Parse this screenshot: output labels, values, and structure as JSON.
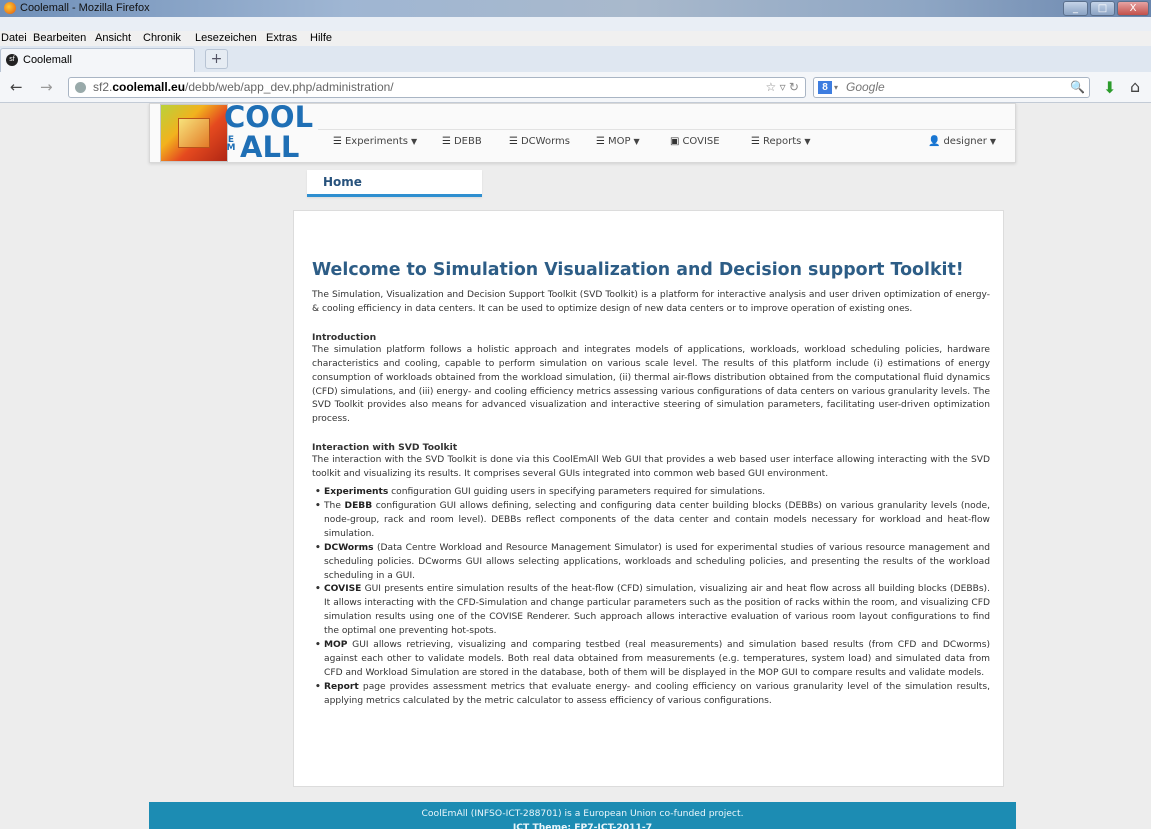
{
  "window": {
    "title": "Coolemall - Mozilla Firefox",
    "minimize_glyph": "_",
    "maximize_glyph": "□",
    "close_glyph": "X"
  },
  "menubar": [
    "Datei",
    "Bearbeiten",
    "Ansicht",
    "Chronik",
    "Lesezeichen",
    "Extras",
    "Hilfe"
  ],
  "tab": {
    "title": "Coolemall",
    "new_tab_glyph": "+"
  },
  "toolbar": {
    "url_prefix": "sf2.",
    "url_domain": "coolemall.eu",
    "url_path": "/debb/web/app_dev.php/administration/",
    "search_placeholder": "Google"
  },
  "site": {
    "logo_top": "COOL",
    "logo_bottom": "ALL",
    "logo_em": "E M",
    "nav": [
      {
        "label": "Experiments",
        "dropdown": true,
        "icon": "list-icon"
      },
      {
        "label": "DEBB",
        "dropdown": false,
        "icon": "list-icon"
      },
      {
        "label": "DCWorms",
        "dropdown": false,
        "icon": "list-icon"
      },
      {
        "label": "MOP",
        "dropdown": true,
        "icon": "list-icon"
      },
      {
        "label": "COVISE",
        "dropdown": false,
        "icon": "film-icon"
      },
      {
        "label": "Reports",
        "dropdown": true,
        "icon": "list-icon"
      }
    ],
    "user_label": "designer",
    "breadcrumb_home": "Home"
  },
  "content": {
    "heading": "Welcome to Simulation Visualization and Decision support Toolkit!",
    "intro": "The Simulation, Visualization and Decision Support Toolkit (SVD Toolkit) is a platform for interactive analysis and user driven optimization of energy- & cooling efficiency in data centers. It can be used to optimize design of new data centers or to improve operation of existing ones.",
    "introduction_heading": "Introduction",
    "introduction_text": "The simulation platform follows a holistic approach and integrates models of applications, workloads, workload scheduling policies, hardware characteristics and cooling, capable to perform simulation on various scale level. The results of this platform include (i) estimations of energy consumption of workloads obtained from the workload simulation, (ii) thermal air-flows distribution obtained from the computational fluid dynamics (CFD) simulations, and (iii) energy- and cooling efficiency metrics assessing various configurations of data centers on various granularity levels. The SVD Toolkit provides also means for advanced visualization and interactive steering of simulation parameters, facilitating user-driven optimization process.",
    "interaction_heading": "Interaction with SVD Toolkit",
    "interaction_text": "The interaction with the SVD Toolkit is done via this CoolEmAll Web GUI that provides a web based user interface allowing interacting with the SVD toolkit and visualizing its results. It comprises several GUIs integrated into common web based GUI environment.",
    "bullets": [
      {
        "pre": "",
        "bold": "Experiments",
        "rest": " configuration GUI guiding users in specifying parameters required for simulations."
      },
      {
        "pre": "The ",
        "bold": "DEBB",
        "rest": " configuration GUI allows defining, selecting and configuring data center building blocks (DEBBs) on various granularity levels (node, node-group, rack and room level). DEBBs reflect components of the data center and contain models necessary for workload and heat-flow simulation."
      },
      {
        "pre": "",
        "bold": "DCWorms",
        "rest": " (Data Centre Workload and Resource Management Simulator) is used for experimental studies of various resource management and scheduling policies. DCworms GUI allows selecting applications, workloads and scheduling policies, and presenting the results of the workload scheduling in a GUI."
      },
      {
        "pre": "",
        "bold": "COVISE",
        "rest": " GUI presents entire simulation results of the heat-flow (CFD) simulation, visualizing air and heat flow across all building blocks (DEBBs). It allows interacting with the CFD-Simulation and change particular parameters such as the position of racks within the room, and visualizing CFD simulation results using one of the COVISE Renderer. Such approach allows interactive evaluation of various room layout configurations to find the optimal one preventing hot-spots."
      },
      {
        "pre": "",
        "bold": "MOP",
        "rest": " GUI allows retrieving, visualizing and comparing testbed (real measurements) and simulation based results (from CFD and DCworms) against each other to validate models. Both real data obtained from measurements (e.g. temperatures, system load) and simulated data from CFD and Workload Simulation are stored in the database, both of them will be displayed in the MOP GUI to compare results and validate models."
      },
      {
        "pre": "",
        "bold": "Report",
        "rest": " page provides assessment metrics that evaluate energy- and cooling efficiency on various granularity level of the simulation results, applying metrics calculated by the metric calculator to assess efficiency of various configurations."
      }
    ]
  },
  "footer": {
    "line1": "CoolEmAll (INFSO-ICT-288701) is a European Union co-funded project.",
    "line2": "ICT Theme: FP7-ICT-2011-7"
  }
}
